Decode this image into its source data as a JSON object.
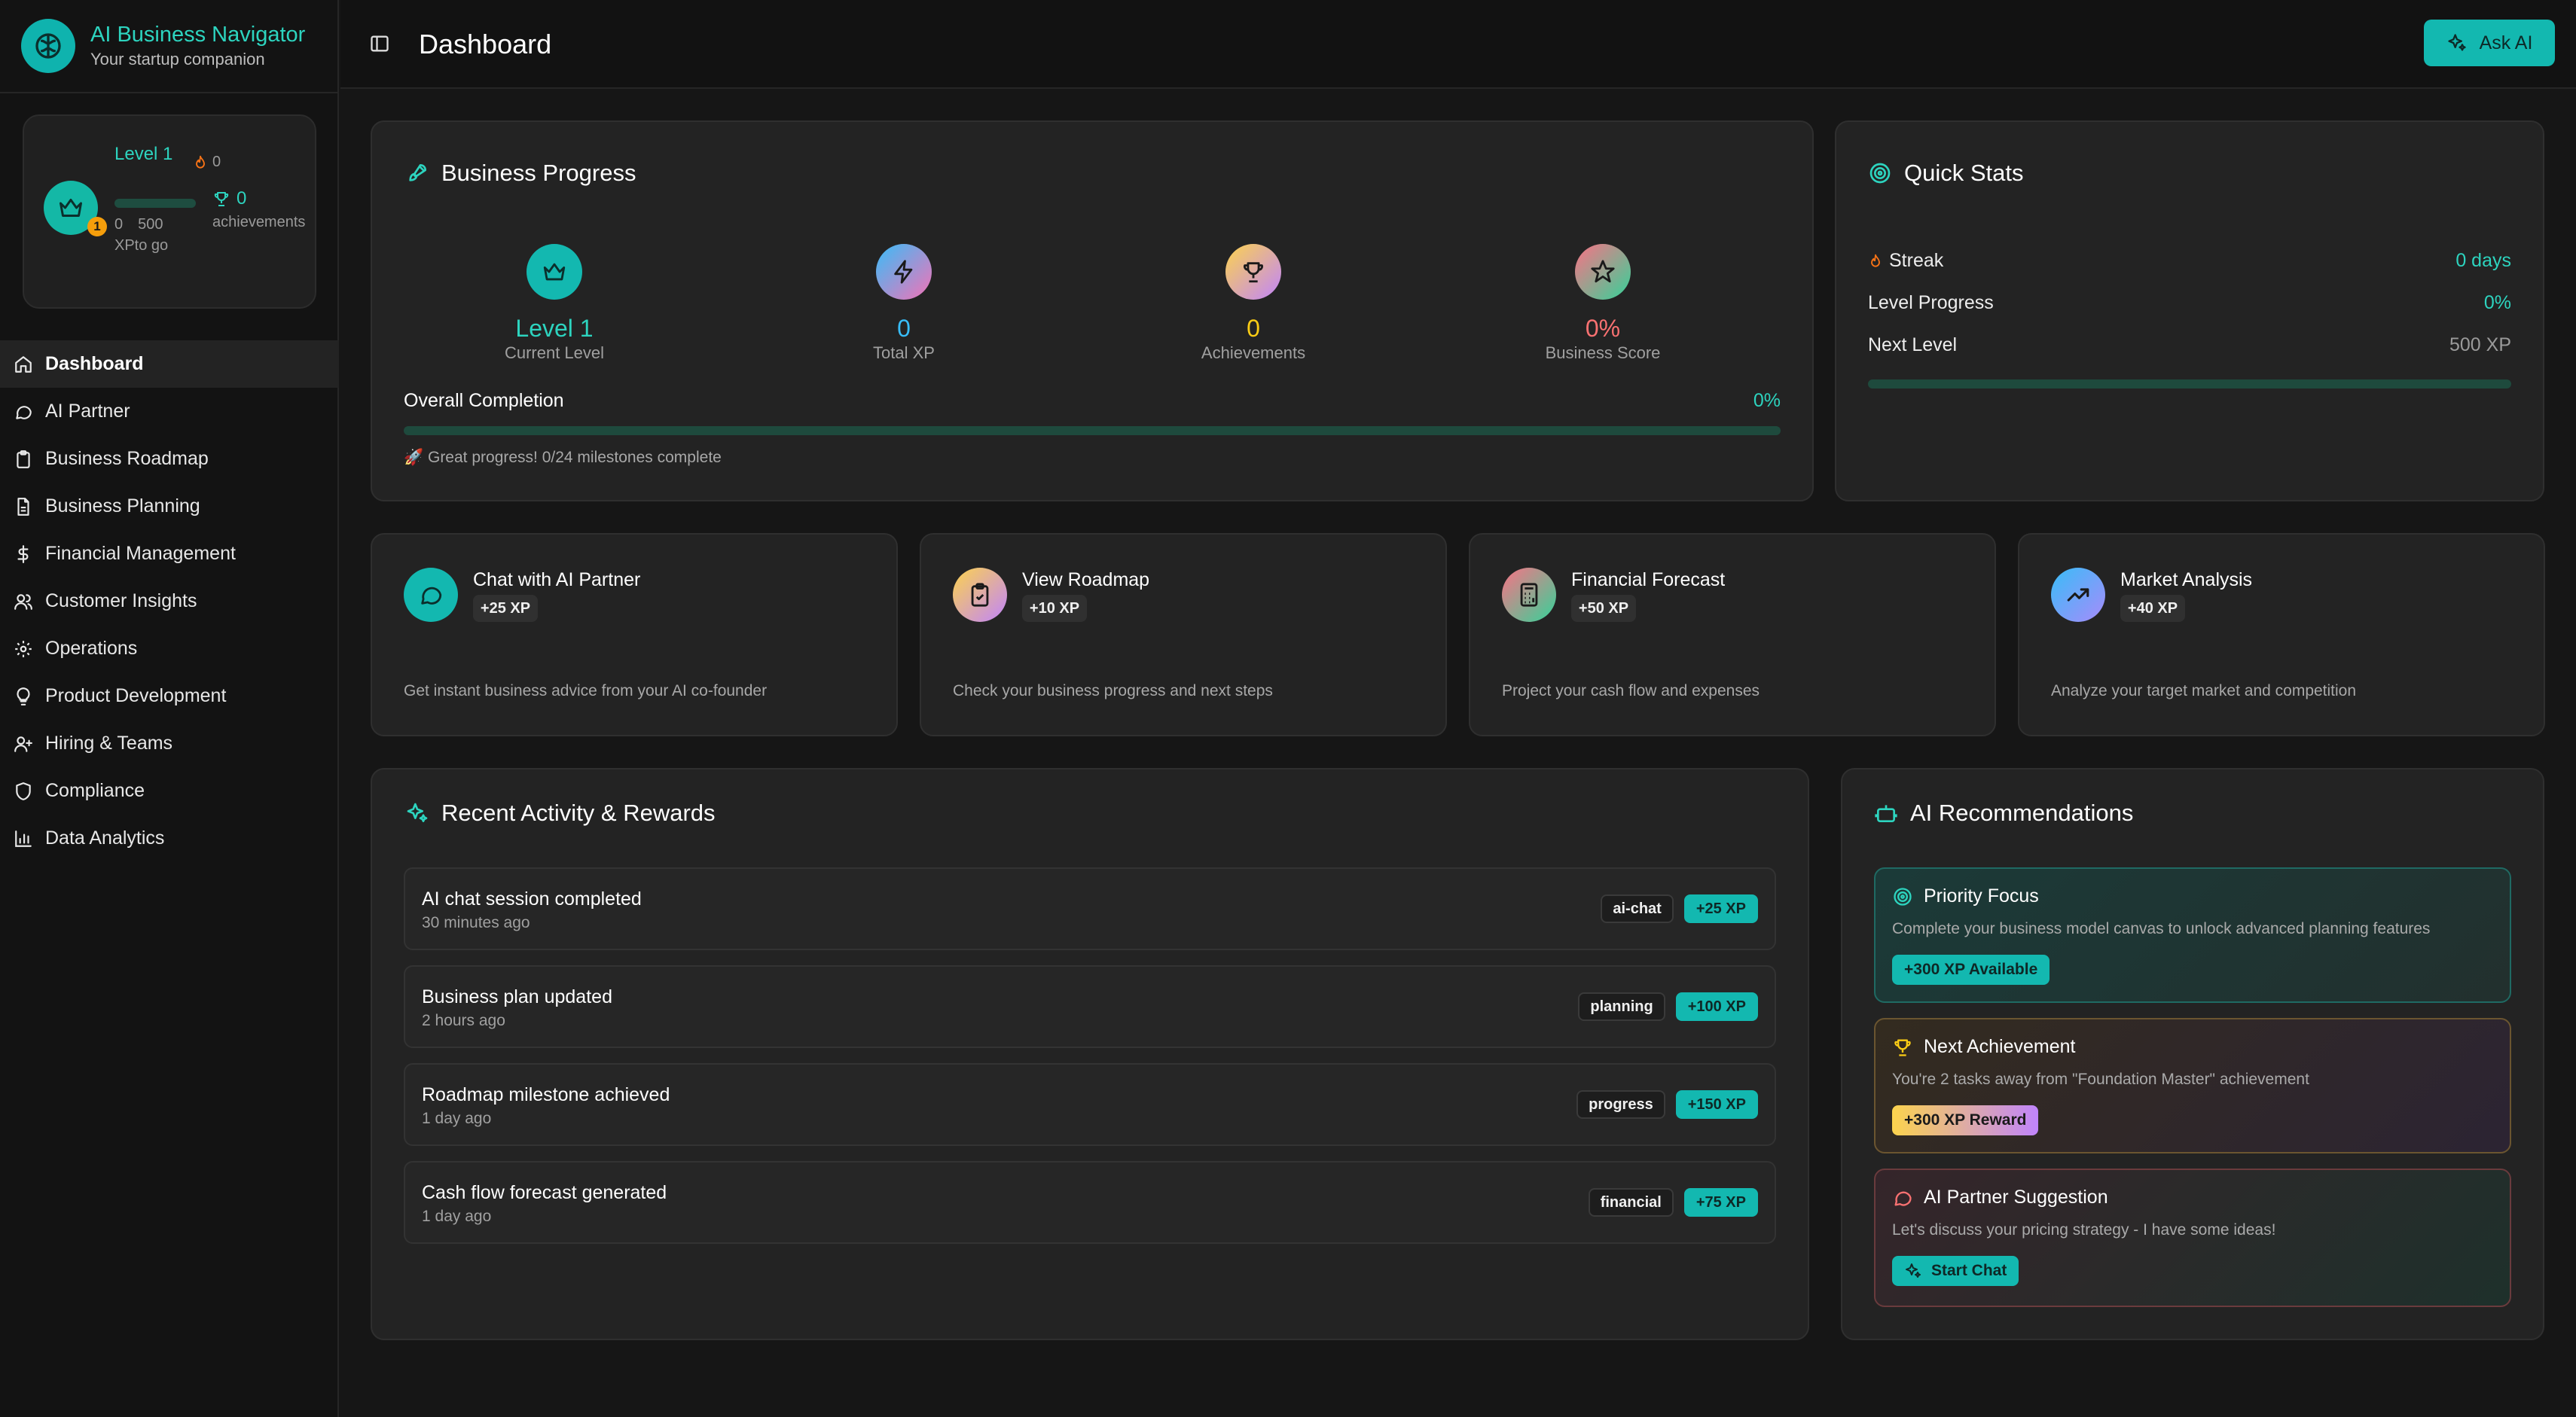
{
  "brand": {
    "title": "AI Business Navigator",
    "subtitle": "Your startup companion"
  },
  "profile": {
    "level": "Level 1",
    "avatar_badge": "1",
    "xp_current": "0",
    "xp_next": "500",
    "xp_to_go": "XPto go",
    "streak": "0",
    "achievements": "0",
    "achievements_label": "achievements",
    "level_progress": 0
  },
  "nav": [
    {
      "label": "Dashboard",
      "icon": "home-icon",
      "active": true
    },
    {
      "label": "AI Partner",
      "icon": "message-circle-icon"
    },
    {
      "label": "Business Roadmap",
      "icon": "clipboard-icon"
    },
    {
      "label": "Business Planning",
      "icon": "file-text-icon"
    },
    {
      "label": "Financial Management",
      "icon": "dollar-icon"
    },
    {
      "label": "Customer Insights",
      "icon": "users-icon"
    },
    {
      "label": "Operations",
      "icon": "gear-icon"
    },
    {
      "label": "Product Development",
      "icon": "lightbulb-icon"
    },
    {
      "label": "Hiring & Teams",
      "icon": "user-plus-icon"
    },
    {
      "label": "Compliance",
      "icon": "shield-icon"
    },
    {
      "label": "Data Analytics",
      "icon": "bar-chart-icon"
    }
  ],
  "topbar": {
    "title": "Dashboard",
    "ask_ai": "Ask AI"
  },
  "business_progress": {
    "title": "Business Progress",
    "stats": [
      {
        "value": "Level 1",
        "label": "Current Level",
        "icon": "crown-icon",
        "color": "#2dd4bf"
      },
      {
        "value": "0",
        "label": "Total XP",
        "icon": "zap-icon",
        "color": "#38bdf8"
      },
      {
        "value": "0",
        "label": "Achievements",
        "icon": "trophy-icon",
        "color": "#facc15"
      },
      {
        "value": "0%",
        "label": "Business Score",
        "icon": "star-icon",
        "color": "#f87171"
      }
    ],
    "overall_label": "Overall Completion",
    "overall_pct": "0%",
    "overall_progress": 0,
    "note": "🚀 Great progress! 0/24 milestones complete"
  },
  "quick_stats": {
    "title": "Quick Stats",
    "streak_label": "Streak",
    "streak_value": "0 days",
    "level_progress_label": "Level Progress",
    "level_progress_value": "0%",
    "next_level_label": "Next Level",
    "next_level_value": "500 XP",
    "progress": 0
  },
  "actions": [
    {
      "title": "Chat with AI Partner",
      "xp": "+25 XP",
      "desc": "Get instant business advice from your AI co-founder",
      "icon": "message-circle-icon"
    },
    {
      "title": "View Roadmap",
      "xp": "+10 XP",
      "desc": "Check your business progress and next steps",
      "icon": "clipboard-check-icon"
    },
    {
      "title": "Financial Forecast",
      "xp": "+50 XP",
      "desc": "Project your cash flow and expenses",
      "icon": "calculator-icon"
    },
    {
      "title": "Market Analysis",
      "xp": "+40 XP",
      "desc": "Analyze your target market and competition",
      "icon": "trending-up-icon"
    }
  ],
  "activity": {
    "title": "Recent Activity & Rewards",
    "items": [
      {
        "title": "AI chat session completed",
        "time": "30 minutes ago",
        "tag": "ai-chat",
        "xp": "+25 XP"
      },
      {
        "title": "Business plan updated",
        "time": "2 hours ago",
        "tag": "planning",
        "xp": "+100 XP"
      },
      {
        "title": "Roadmap milestone achieved",
        "time": "1 day ago",
        "tag": "progress",
        "xp": "+150 XP"
      },
      {
        "title": "Cash flow forecast generated",
        "time": "1 day ago",
        "tag": "financial",
        "xp": "+75 XP"
      }
    ]
  },
  "recommendations": {
    "title": "AI Recommendations",
    "items": [
      {
        "title": "Priority Focus",
        "desc": "Complete your business model canvas to unlock advanced planning features",
        "button": "+300 XP Available",
        "icon": "target-icon"
      },
      {
        "title": "Next Achievement",
        "desc": "You're 2 tasks away from \"Foundation Master\" achievement",
        "button": "+300 XP Reward",
        "icon": "trophy-icon"
      },
      {
        "title": "AI Partner Suggestion",
        "desc": "Let's discuss your pricing strategy - I have some ideas!",
        "button": "Start Chat",
        "icon": "message-circle-icon"
      }
    ]
  },
  "colors": {
    "accent": "#13b8b0",
    "teal_text": "#2dd4bf",
    "background": "#161616",
    "card": "#232323"
  }
}
